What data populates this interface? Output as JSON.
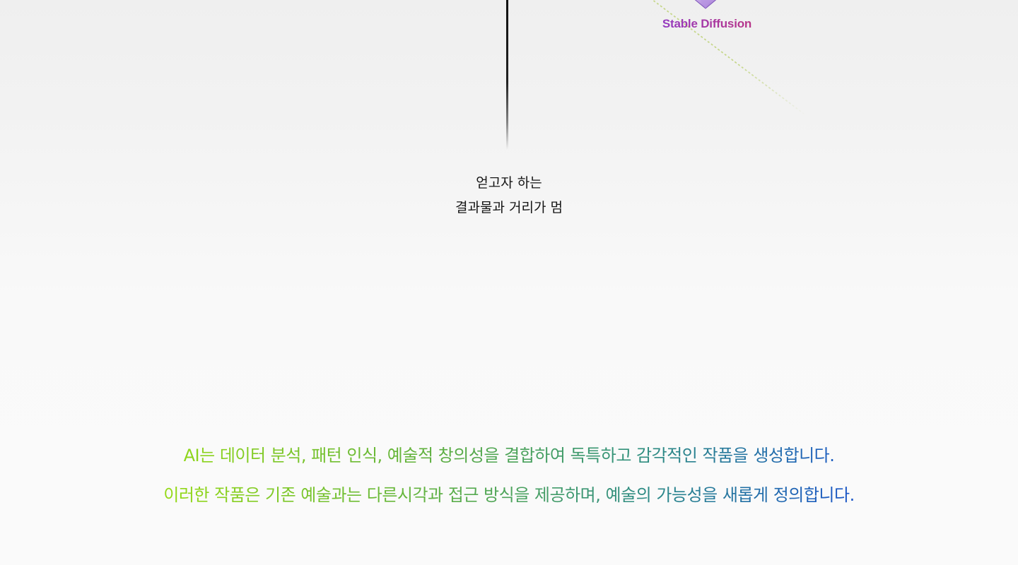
{
  "diagram": {
    "node_label": "Stable Diffusion",
    "caption_lines": [
      "얻고자 하는",
      "결과물과 거리가 멈"
    ],
    "gem_icon": "diamond-gem-icon",
    "colors": {
      "label_start": "#8a3cd0",
      "label_end": "#c23478",
      "caption": "#161616"
    }
  },
  "description": {
    "lines": [
      "AI는 데이터 분석, 패턴 인식, 예술적 창의성을 결합하여 독특하고 감각적인 작품을 생성합니다.",
      "이러한 작품은 기존 예술과는 다른시각과 접근 방식을 제공하며, 예술의 가능성을 새롭게 정의합니다."
    ],
    "colors": {
      "gradient_start": "#8fd61a",
      "gradient_end": "#1d5ec0"
    }
  }
}
